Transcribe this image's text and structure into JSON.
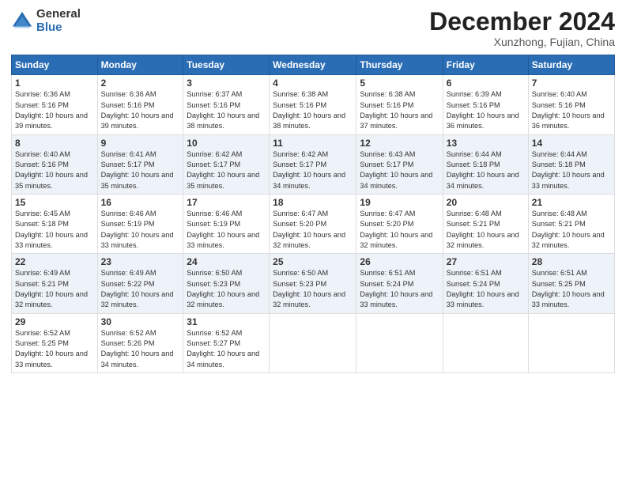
{
  "header": {
    "logo_general": "General",
    "logo_blue": "Blue",
    "month_title": "December 2024",
    "location": "Xunzhong, Fujian, China"
  },
  "weekdays": [
    "Sunday",
    "Monday",
    "Tuesday",
    "Wednesday",
    "Thursday",
    "Friday",
    "Saturday"
  ],
  "weeks": [
    [
      {
        "day": "1",
        "sunrise": "6:36 AM",
        "sunset": "5:16 PM",
        "daylight": "10 hours and 39 minutes."
      },
      {
        "day": "2",
        "sunrise": "6:36 AM",
        "sunset": "5:16 PM",
        "daylight": "10 hours and 39 minutes."
      },
      {
        "day": "3",
        "sunrise": "6:37 AM",
        "sunset": "5:16 PM",
        "daylight": "10 hours and 38 minutes."
      },
      {
        "day": "4",
        "sunrise": "6:38 AM",
        "sunset": "5:16 PM",
        "daylight": "10 hours and 38 minutes."
      },
      {
        "day": "5",
        "sunrise": "6:38 AM",
        "sunset": "5:16 PM",
        "daylight": "10 hours and 37 minutes."
      },
      {
        "day": "6",
        "sunrise": "6:39 AM",
        "sunset": "5:16 PM",
        "daylight": "10 hours and 36 minutes."
      },
      {
        "day": "7",
        "sunrise": "6:40 AM",
        "sunset": "5:16 PM",
        "daylight": "10 hours and 36 minutes."
      }
    ],
    [
      {
        "day": "8",
        "sunrise": "6:40 AM",
        "sunset": "5:16 PM",
        "daylight": "10 hours and 35 minutes."
      },
      {
        "day": "9",
        "sunrise": "6:41 AM",
        "sunset": "5:17 PM",
        "daylight": "10 hours and 35 minutes."
      },
      {
        "day": "10",
        "sunrise": "6:42 AM",
        "sunset": "5:17 PM",
        "daylight": "10 hours and 35 minutes."
      },
      {
        "day": "11",
        "sunrise": "6:42 AM",
        "sunset": "5:17 PM",
        "daylight": "10 hours and 34 minutes."
      },
      {
        "day": "12",
        "sunrise": "6:43 AM",
        "sunset": "5:17 PM",
        "daylight": "10 hours and 34 minutes."
      },
      {
        "day": "13",
        "sunrise": "6:44 AM",
        "sunset": "5:18 PM",
        "daylight": "10 hours and 34 minutes."
      },
      {
        "day": "14",
        "sunrise": "6:44 AM",
        "sunset": "5:18 PM",
        "daylight": "10 hours and 33 minutes."
      }
    ],
    [
      {
        "day": "15",
        "sunrise": "6:45 AM",
        "sunset": "5:18 PM",
        "daylight": "10 hours and 33 minutes."
      },
      {
        "day": "16",
        "sunrise": "6:46 AM",
        "sunset": "5:19 PM",
        "daylight": "10 hours and 33 minutes."
      },
      {
        "day": "17",
        "sunrise": "6:46 AM",
        "sunset": "5:19 PM",
        "daylight": "10 hours and 33 minutes."
      },
      {
        "day": "18",
        "sunrise": "6:47 AM",
        "sunset": "5:20 PM",
        "daylight": "10 hours and 32 minutes."
      },
      {
        "day": "19",
        "sunrise": "6:47 AM",
        "sunset": "5:20 PM",
        "daylight": "10 hours and 32 minutes."
      },
      {
        "day": "20",
        "sunrise": "6:48 AM",
        "sunset": "5:21 PM",
        "daylight": "10 hours and 32 minutes."
      },
      {
        "day": "21",
        "sunrise": "6:48 AM",
        "sunset": "5:21 PM",
        "daylight": "10 hours and 32 minutes."
      }
    ],
    [
      {
        "day": "22",
        "sunrise": "6:49 AM",
        "sunset": "5:21 PM",
        "daylight": "10 hours and 32 minutes."
      },
      {
        "day": "23",
        "sunrise": "6:49 AM",
        "sunset": "5:22 PM",
        "daylight": "10 hours and 32 minutes."
      },
      {
        "day": "24",
        "sunrise": "6:50 AM",
        "sunset": "5:23 PM",
        "daylight": "10 hours and 32 minutes."
      },
      {
        "day": "25",
        "sunrise": "6:50 AM",
        "sunset": "5:23 PM",
        "daylight": "10 hours and 32 minutes."
      },
      {
        "day": "26",
        "sunrise": "6:51 AM",
        "sunset": "5:24 PM",
        "daylight": "10 hours and 33 minutes."
      },
      {
        "day": "27",
        "sunrise": "6:51 AM",
        "sunset": "5:24 PM",
        "daylight": "10 hours and 33 minutes."
      },
      {
        "day": "28",
        "sunrise": "6:51 AM",
        "sunset": "5:25 PM",
        "daylight": "10 hours and 33 minutes."
      }
    ],
    [
      {
        "day": "29",
        "sunrise": "6:52 AM",
        "sunset": "5:25 PM",
        "daylight": "10 hours and 33 minutes."
      },
      {
        "day": "30",
        "sunrise": "6:52 AM",
        "sunset": "5:26 PM",
        "daylight": "10 hours and 34 minutes."
      },
      {
        "day": "31",
        "sunrise": "6:52 AM",
        "sunset": "5:27 PM",
        "daylight": "10 hours and 34 minutes."
      },
      null,
      null,
      null,
      null
    ]
  ]
}
